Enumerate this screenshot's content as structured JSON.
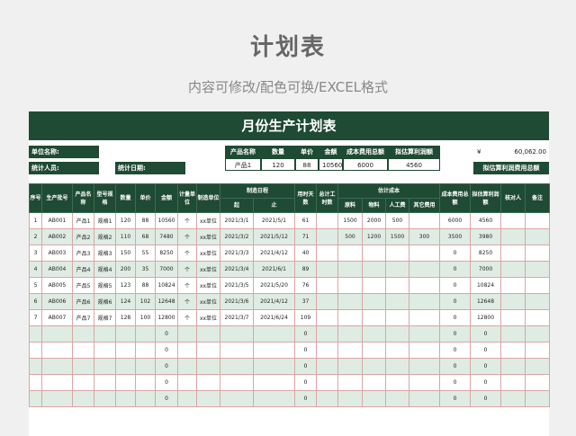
{
  "header": {
    "title": "计划表",
    "subtitle": "内容可修改/配色可换/EXCEL格式"
  },
  "sheet": {
    "title": "月份生产计划表",
    "info": {
      "unit_name_label": "单位名称:",
      "statistician_label": "统计人员:",
      "stat_date_label": "统计日期:",
      "summary_headers": [
        "产品名称",
        "数量",
        "单价",
        "金额",
        "成本费用总额",
        "拟估算利润额"
      ],
      "summary_values": [
        "产品1",
        "120",
        "88",
        "10560",
        "6000",
        "4560"
      ],
      "currency_symbol": "¥",
      "total_amount": "60,062.00",
      "profit_total_label": "拟估算利润费用总额"
    },
    "columns": {
      "seq": "序号",
      "batch": "生产批号",
      "product": "产品名称",
      "model": "型号规格",
      "qty": "数量",
      "price": "单价",
      "amount": "金额",
      "unit": "计量单位",
      "maker": "制造单位",
      "schedule": "制造日程",
      "start": "起",
      "end": "止",
      "days": "用时天数",
      "total_hours": "总计工时数",
      "cost": "估计成本",
      "material": "原料",
      "goods": "物料",
      "labor": "人工费",
      "other": "其它费用",
      "total_cost": "成本费用总额",
      "profit": "拟估算利润额",
      "checker": "核对人",
      "remark": "备注"
    },
    "rows": [
      [
        "1",
        "AB001",
        "产品1",
        "规格1",
        "120",
        "88",
        "10560",
        "个",
        "xx单位",
        "2021/3/1",
        "2021/5/1",
        "61",
        "",
        "1500",
        "2000",
        "500",
        "",
        "6000",
        "4560",
        "",
        ""
      ],
      [
        "2",
        "AB002",
        "产品2",
        "规格2",
        "110",
        "68",
        "7480",
        "个",
        "xx单位",
        "2021/3/2",
        "2021/5/12",
        "71",
        "",
        "500",
        "1200",
        "1500",
        "300",
        "3500",
        "3980",
        "",
        ""
      ],
      [
        "3",
        "AB003",
        "产品3",
        "规格3",
        "150",
        "55",
        "8250",
        "个",
        "xx单位",
        "2021/3/3",
        "2021/4/12",
        "40",
        "",
        "",
        "",
        "",
        "",
        "0",
        "8250",
        "",
        ""
      ],
      [
        "4",
        "AB004",
        "产品4",
        "规格4",
        "200",
        "35",
        "7000",
        "个",
        "xx单位",
        "2021/3/4",
        "2021/6/1",
        "89",
        "",
        "",
        "",
        "",
        "",
        "0",
        "7000",
        "",
        ""
      ],
      [
        "5",
        "AB005",
        "产品5",
        "规格5",
        "123",
        "88",
        "10824",
        "个",
        "xx单位",
        "2021/3/5",
        "2021/5/20",
        "76",
        "",
        "",
        "",
        "",
        "",
        "0",
        "10824",
        "",
        ""
      ],
      [
        "6",
        "AB006",
        "产品6",
        "规格6",
        "124",
        "102",
        "12648",
        "个",
        "xx单位",
        "2021/3/6",
        "2021/4/12",
        "37",
        "",
        "",
        "",
        "",
        "",
        "0",
        "12648",
        "",
        ""
      ],
      [
        "7",
        "AB007",
        "产品7",
        "规格7",
        "128",
        "100",
        "12800",
        "个",
        "xx单位",
        "2021/3/7",
        "2021/6/24",
        "109",
        "",
        "",
        "",
        "",
        "",
        "0",
        "12800",
        "",
        ""
      ],
      [
        "",
        "",
        "",
        "",
        "",
        "",
        "0",
        "",
        "",
        "",
        "",
        "0",
        "",
        "",
        "",
        "",
        "",
        "0",
        "0",
        "",
        ""
      ],
      [
        "",
        "",
        "",
        "",
        "",
        "",
        "0",
        "",
        "",
        "",
        "",
        "0",
        "",
        "",
        "",
        "",
        "",
        "0",
        "0",
        "",
        ""
      ],
      [
        "",
        "",
        "",
        "",
        "",
        "",
        "0",
        "",
        "",
        "",
        "",
        "0",
        "",
        "",
        "",
        "",
        "",
        "0",
        "0",
        "",
        ""
      ],
      [
        "",
        "",
        "",
        "",
        "",
        "",
        "0",
        "",
        "",
        "",
        "",
        "0",
        "",
        "",
        "",
        "",
        "",
        "0",
        "0",
        "",
        ""
      ],
      [
        "",
        "",
        "",
        "",
        "",
        "",
        "0",
        "",
        "",
        "",
        "",
        "0",
        "",
        "",
        "",
        "",
        "",
        "0",
        "0",
        "",
        ""
      ]
    ]
  }
}
